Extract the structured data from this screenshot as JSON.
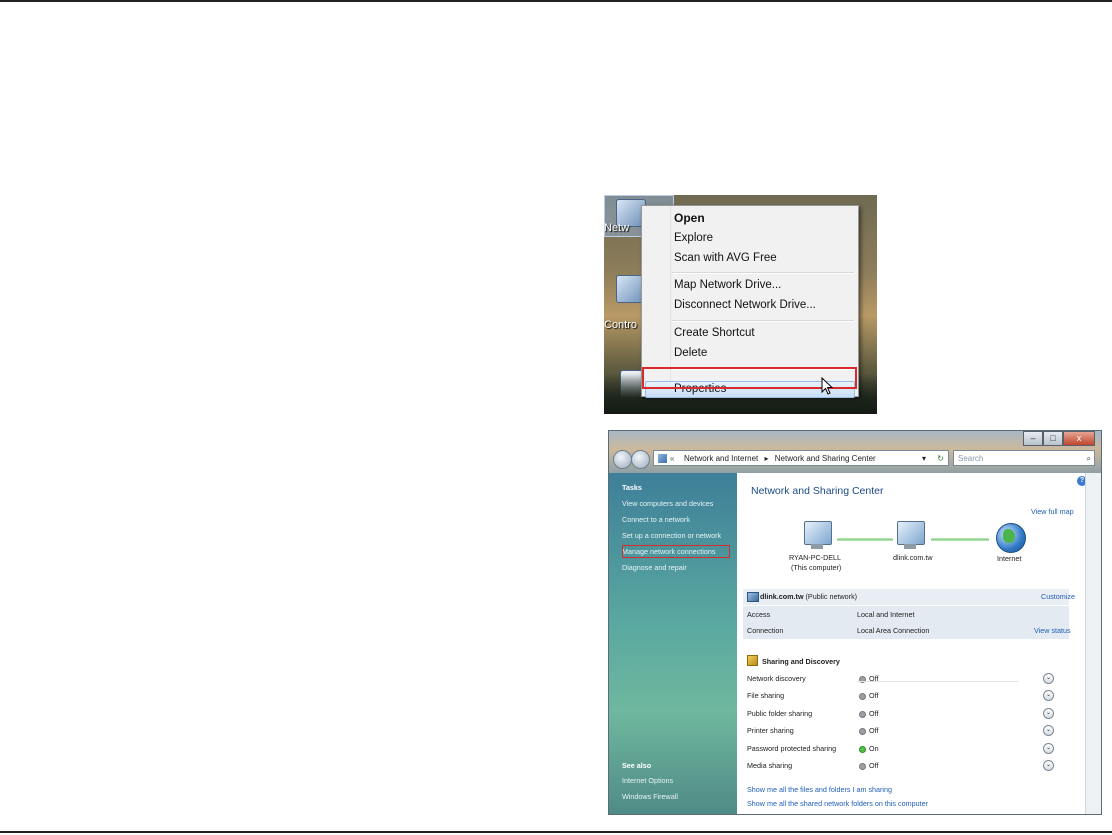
{
  "context_menu": {
    "desktop_labels": [
      "Netw",
      "Contro"
    ],
    "items": [
      "Open",
      "Explore",
      "Scan with AVG Free",
      "Map Network Drive...",
      "Disconnect Network Drive...",
      "Create Shortcut",
      "Delete",
      "Properties"
    ]
  },
  "window": {
    "buttons": {
      "minimize": "–",
      "maximize": "□",
      "close": "x"
    },
    "address": {
      "prefix": "«",
      "crumb1": "Network and Internet",
      "sep": "▸",
      "crumb2": "Network and Sharing Center",
      "dropdown": "▾",
      "refresh": "↻"
    },
    "search_placeholder": "Search",
    "search_icon": "⌕",
    "sidebar": {
      "tasks_header": "Tasks",
      "tasks": [
        "View computers and devices",
        "Connect to a network",
        "Set up a connection or network",
        "Manage network connections",
        "Diagnose and repair"
      ],
      "see_also_header": "See also",
      "see_also": [
        "Internet Options",
        "Windows Firewall"
      ]
    },
    "main": {
      "help": "?",
      "title": "Network and Sharing Center",
      "view_full_map": "View full map",
      "map": {
        "computer_name": "RYAN-PC-DELL",
        "computer_sub": "(This computer)",
        "network": "dlink.com.tw",
        "internet": "Internet"
      },
      "network": {
        "name": "dlink.com.tw",
        "type": "(Public network)",
        "customize": "Customize",
        "access_label": "Access",
        "access_value": "Local and Internet",
        "connection_label": "Connection",
        "connection_value": "Local Area Connection",
        "view_status": "View status"
      },
      "sharing": {
        "header": "Sharing and Discovery",
        "rows": [
          {
            "label": "Network discovery",
            "value": "Off"
          },
          {
            "label": "File sharing",
            "value": "Off"
          },
          {
            "label": "Public folder sharing",
            "value": "Off"
          },
          {
            "label": "Printer sharing",
            "value": "Off"
          },
          {
            "label": "Password protected sharing",
            "value": "On"
          },
          {
            "label": "Media sharing",
            "value": "Off"
          }
        ]
      },
      "links": [
        "Show me all the files and folders I am sharing",
        "Show me all the shared network folders on this computer"
      ]
    }
  }
}
